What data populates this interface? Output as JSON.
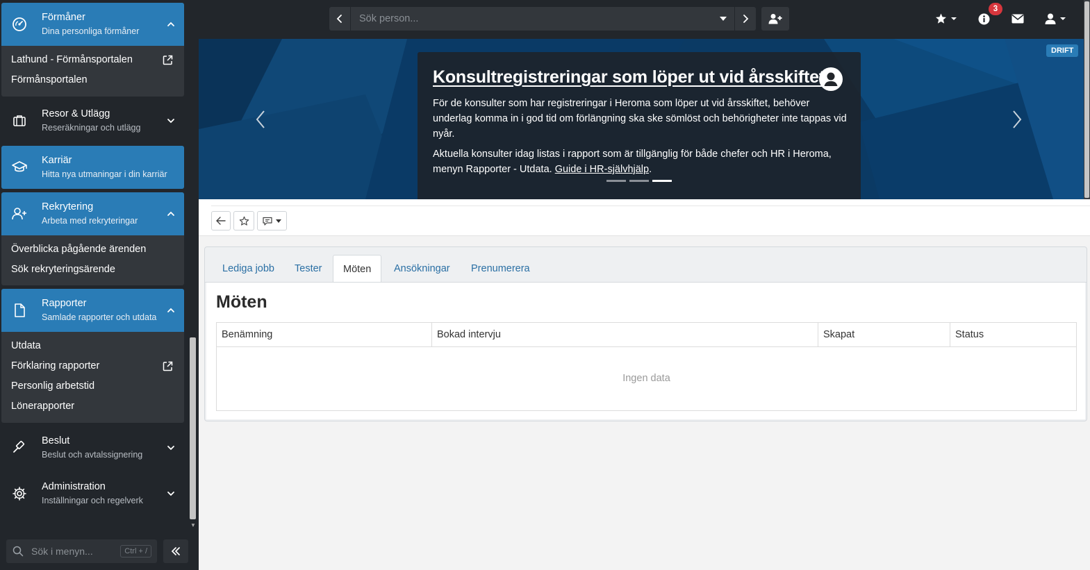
{
  "topbar": {
    "search_placeholder": "Sök person...",
    "notification_count": "3"
  },
  "sidebar": {
    "sections": [
      {
        "id": "formaner",
        "title": "Förmåner",
        "subtitle": "Dina personliga förmåner",
        "icon": "gauge-icon",
        "expanded": true,
        "items": [
          {
            "label": "Lathund - Förmånsportalen",
            "external": true
          },
          {
            "label": "Förmånsportalen",
            "external": false
          }
        ]
      },
      {
        "id": "resor",
        "title": "Resor & Utlägg",
        "subtitle": "Reseräkningar och utlägg",
        "icon": "suitcase-icon",
        "expanded": false,
        "items": []
      },
      {
        "id": "karriar",
        "title": "Karriär",
        "subtitle": "Hitta nya utmaningar i din karriär",
        "icon": "graduation-cap-icon",
        "expanded": false,
        "highlighted": true,
        "items": []
      },
      {
        "id": "rekrytering",
        "title": "Rekrytering",
        "subtitle": "Arbeta med rekryteringar",
        "icon": "user-plus-icon",
        "expanded": true,
        "items": [
          {
            "label": "Överblicka pågående ärenden",
            "external": false
          },
          {
            "label": "Sök rekryteringsärende",
            "external": false
          }
        ]
      },
      {
        "id": "rapporter",
        "title": "Rapporter",
        "subtitle": "Samlade rapporter och utdata",
        "icon": "document-icon",
        "expanded": true,
        "items": [
          {
            "label": "Utdata",
            "external": false
          },
          {
            "label": "Förklaring rapporter",
            "external": true
          },
          {
            "label": "Personlig arbetstid",
            "external": false
          },
          {
            "label": "Lönerapporter",
            "external": false
          }
        ]
      },
      {
        "id": "beslut",
        "title": "Beslut",
        "subtitle": "Beslut och avtalssignering",
        "icon": "gavel-icon",
        "expanded": false,
        "items": []
      },
      {
        "id": "administration",
        "title": "Administration",
        "subtitle": "Inställningar och regelverk",
        "icon": "gear-icon",
        "expanded": false,
        "items": []
      }
    ],
    "menu_search_placeholder": "Sök i menyn...",
    "menu_search_shortcut": "Ctrl + /"
  },
  "banner": {
    "badge": "DRIFT",
    "title": "Konsultregistreringar som löper ut vid årsskiftet",
    "paragraph1": "För de konsulter som har registreringar i Heroma som löper ut vid årsskiftet, behöver underlag komma in i god tid om förlängning ska ske sömlöst och behörigheter inte tappas vid nyår.",
    "paragraph2_prefix": "Aktuella konsulter idag listas i rapport som är tillgänglig för både chefer och HR i Heroma, menyn Rapporter - Utdata.",
    "paragraph2_link": "Guide i HR-självhjälp",
    "paragraph2_suffix": ".",
    "slide_count": 3,
    "active_slide": 3
  },
  "tabs": [
    {
      "label": "Lediga jobb",
      "active": false
    },
    {
      "label": "Tester",
      "active": false
    },
    {
      "label": "Möten",
      "active": true
    },
    {
      "label": "Ansökningar",
      "active": false
    },
    {
      "label": "Prenumerera",
      "active": false
    }
  ],
  "content": {
    "title": "Möten",
    "columns": [
      "Benämning",
      "Bokad intervju",
      "Skapat",
      "Status"
    ],
    "empty_text": "Ingen data"
  },
  "colors": {
    "sidebar_bg": "#22262b",
    "accent_blue": "#2a7cb6",
    "banner_blue": "#0c3f6c",
    "badge_red": "#d7363d",
    "link_blue": "#2a6fa4"
  }
}
